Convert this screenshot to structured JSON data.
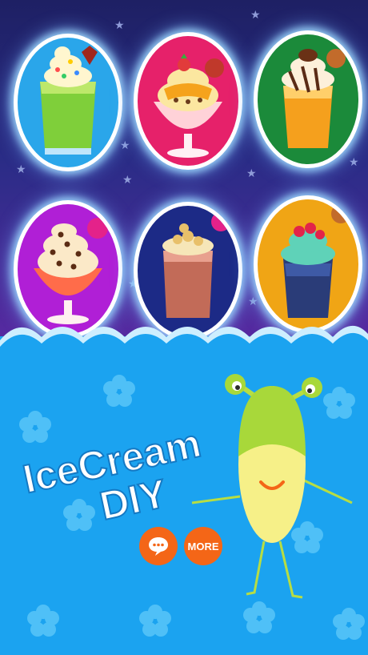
{
  "title": {
    "line1": "IceCream",
    "line2": "DIY"
  },
  "buttons": {
    "chat_icon": "speech-bubble-icon",
    "more_label": "MORE"
  },
  "desserts": [
    {
      "name": "green-smoothie-glass",
      "background": "#2aa6ea"
    },
    {
      "name": "strawberry-sundae-cup",
      "background": "#e6216a"
    },
    {
      "name": "orange-chocolate-shake",
      "background": "#1b8a3a"
    },
    {
      "name": "chocolate-chip-sundae",
      "background": "#b01fd6"
    },
    {
      "name": "peach-crunch-shake",
      "background": "#1c2a86"
    },
    {
      "name": "blue-berry-shake",
      "background": "#f0a515"
    }
  ],
  "colors": {
    "night_sky": "#2a2c86",
    "water": "#1ba3f0",
    "button_orange": "#f46617",
    "monster_green": "#a8d83a",
    "monster_yellow": "#f6f088"
  }
}
